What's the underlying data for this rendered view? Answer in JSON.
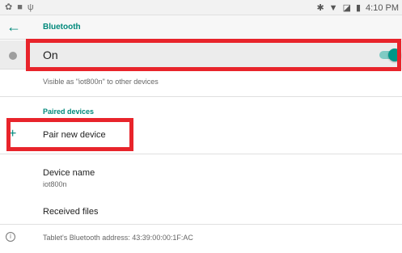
{
  "status_bar": {
    "left_icons": [
      "gear-icon",
      "image-icon",
      "usb-icon"
    ],
    "time": "4:10 PM"
  },
  "toolbar": {
    "title": "Bluetooth"
  },
  "switch": {
    "label": "On",
    "state": "on"
  },
  "visible_as": "Visible as \"iot800n\" to other devices",
  "paired_devices": {
    "header": "Paired devices",
    "pair_new_label": "Pair new device"
  },
  "device_name": {
    "title": "Device name",
    "value": "iot800n"
  },
  "received_files": "Received files",
  "bt_address": "Tablet's Bluetooth address: 43:39:00:00:1F:AC",
  "colors": {
    "accent": "#00897b",
    "highlight": "#e8242b"
  }
}
